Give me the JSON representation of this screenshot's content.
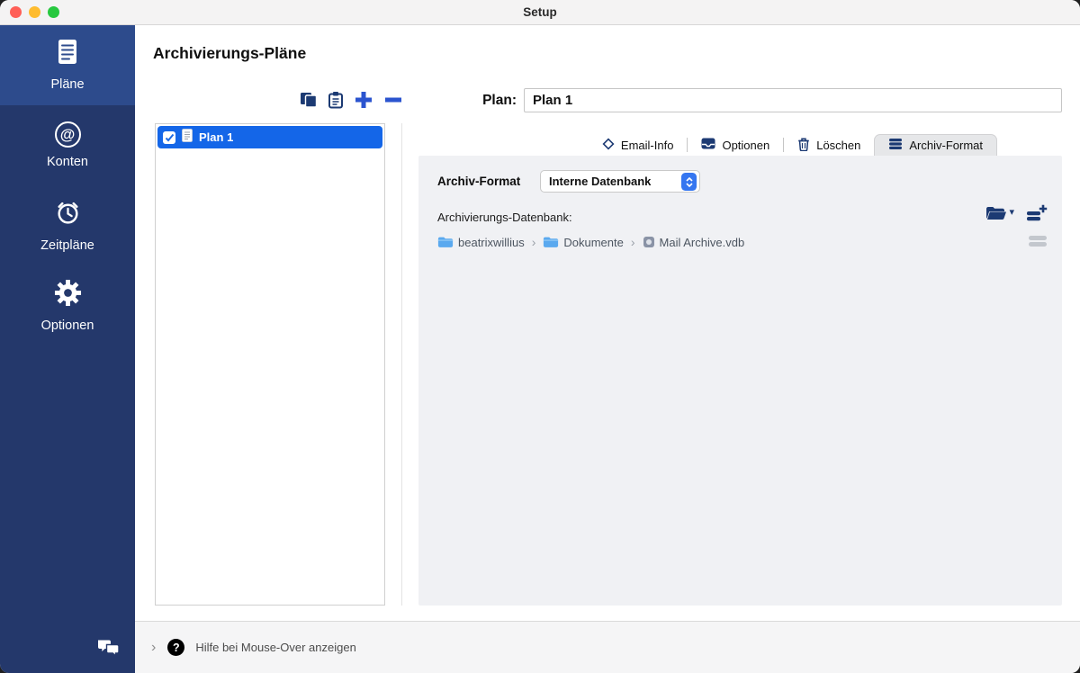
{
  "window": {
    "title": "Setup"
  },
  "sidebar": {
    "items": [
      {
        "label": "Pläne"
      },
      {
        "label": "Konten"
      },
      {
        "label": "Zeitpläne"
      },
      {
        "label": "Optionen"
      }
    ]
  },
  "header": {
    "title": "Archivierungs-Pläne"
  },
  "plan_list": {
    "rows": [
      {
        "label": "Plan 1",
        "checked": true
      }
    ]
  },
  "plan_field": {
    "label": "Plan:",
    "value": "Plan 1"
  },
  "tabs": [
    {
      "label": "Email-Info"
    },
    {
      "label": "Optionen"
    },
    {
      "label": "Löschen"
    },
    {
      "label": "Archiv-Format",
      "active": true
    }
  ],
  "archive_panel": {
    "format_label": "Archiv-Format",
    "format_value": "Interne Datenbank",
    "database_label": "Archivierungs-Datenbank:",
    "path": [
      {
        "label": "beatrixwillius"
      },
      {
        "label": "Dokumente"
      },
      {
        "label": "Mail Archive.vdb"
      }
    ]
  },
  "footer": {
    "help_text": "Hilfe bei Mouse-Over anzeigen"
  },
  "icons": {
    "at": "@",
    "path_separator": "›",
    "caret_down": "▾",
    "help": "?",
    "disclosure": "›"
  },
  "colors": {
    "sidebar_bg": "#24386b",
    "sidebar_active_bg": "#2d4b8c",
    "selection_blue": "#1466e8",
    "accent_blue": "#2b54cf"
  }
}
